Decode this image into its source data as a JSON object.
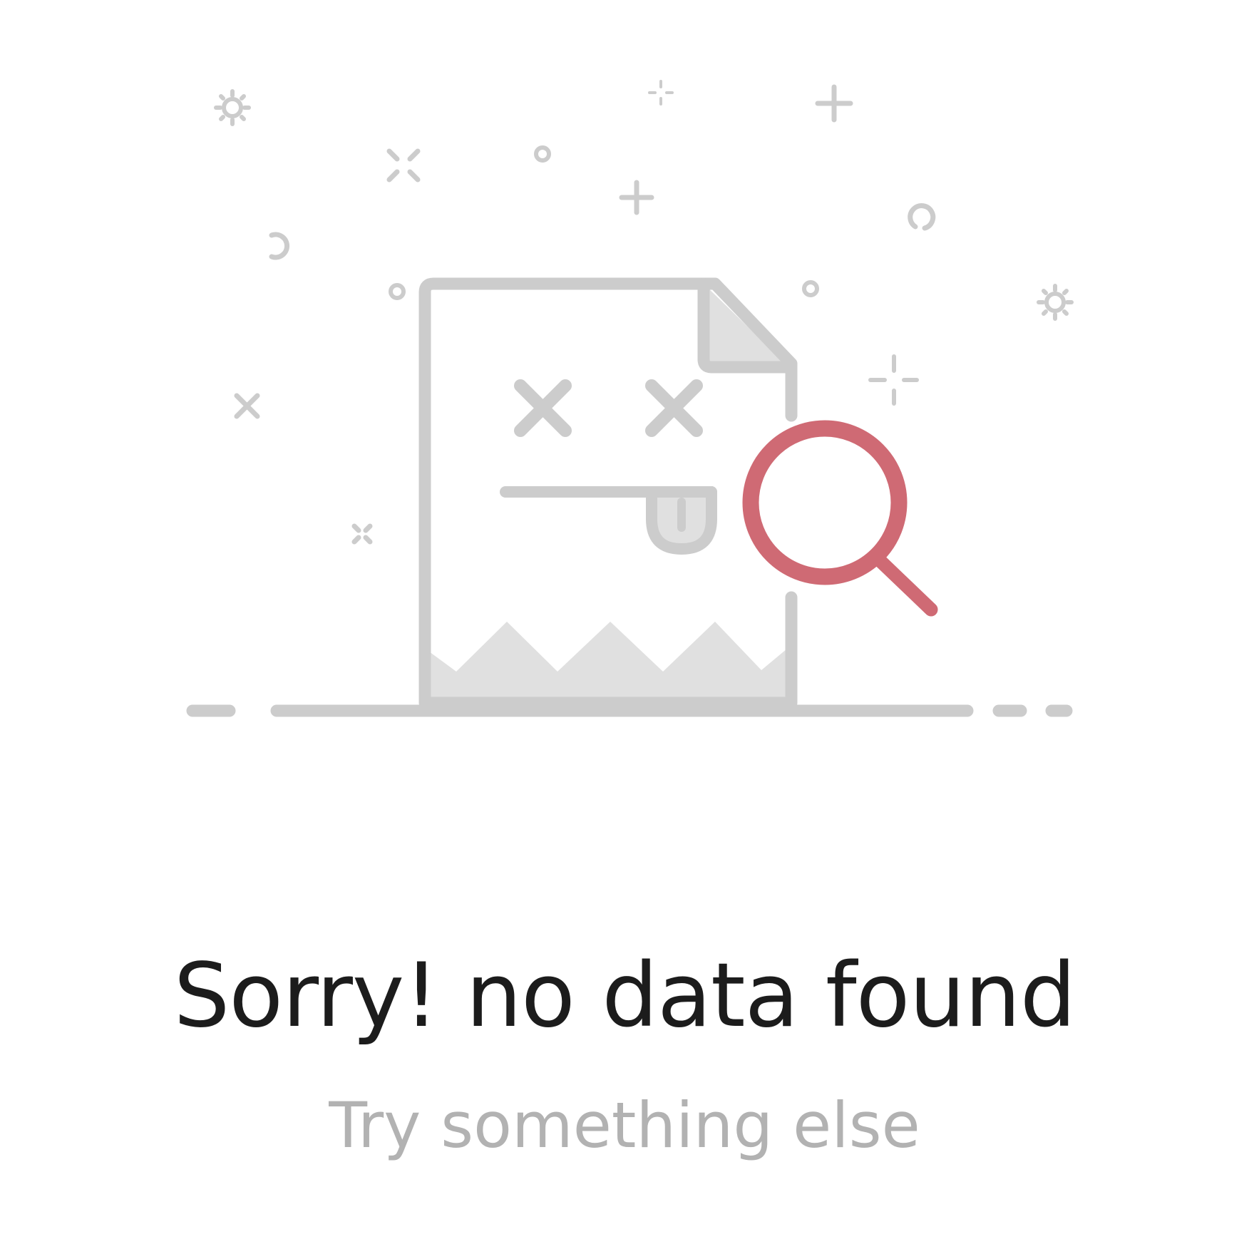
{
  "empty_state": {
    "title": "Sorry!  no data found",
    "subtitle": "Try something else",
    "illustration_icon": "no-data-document-search-icon",
    "colors": {
      "background": "#ffffff",
      "title": "#1c1c1c",
      "subtitle": "#b2b2b2",
      "line_art": "#cccccc",
      "fill": "#e0e0e0",
      "accent": "#cf6a74"
    }
  }
}
